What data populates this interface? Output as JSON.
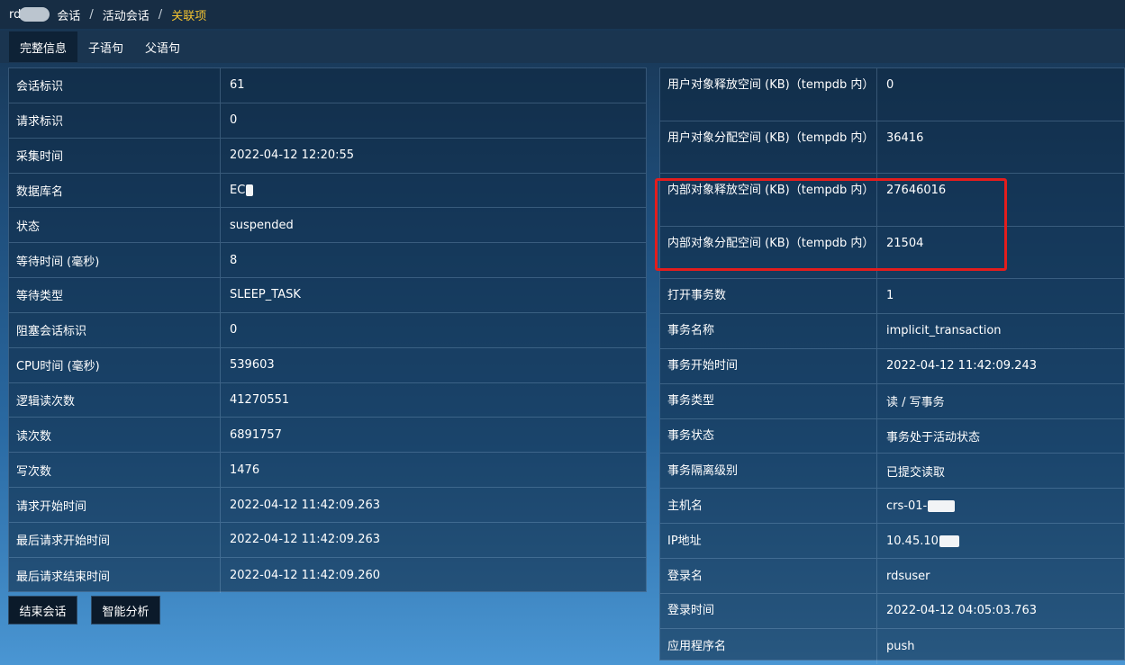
{
  "breadcrumb": {
    "root": "rd",
    "items": [
      "会话",
      "活动会话"
    ],
    "current": "关联项"
  },
  "tabs": [
    "完整信息",
    "子语句",
    "父语句"
  ],
  "left_rows": [
    {
      "key": "会话标识",
      "value": "61"
    },
    {
      "key": "请求标识",
      "value": "0"
    },
    {
      "key": "采集时间",
      "value": "2022-04-12 12:20:55"
    },
    {
      "key": "数据库名",
      "value": "EC"
    },
    {
      "key": "状态",
      "value": "suspended"
    },
    {
      "key": "等待时间 (毫秒)",
      "value": "8"
    },
    {
      "key": "等待类型",
      "value": "SLEEP_TASK"
    },
    {
      "key": "阻塞会话标识",
      "value": "0"
    },
    {
      "key": "CPU时间 (毫秒)",
      "value": "539603"
    },
    {
      "key": "逻辑读次数",
      "value": "41270551"
    },
    {
      "key": "读次数",
      "value": "6891757"
    },
    {
      "key": "写次数",
      "value": "1476"
    },
    {
      "key": "请求开始时间",
      "value": "2022-04-12 11:42:09.263"
    },
    {
      "key": "最后请求开始时间",
      "value": "2022-04-12 11:42:09.263"
    },
    {
      "key": "最后请求结束时间",
      "value": "2022-04-12 11:42:09.260"
    }
  ],
  "right_rows": [
    {
      "key": "用户对象释放空间 (KB)（tempdb 内）",
      "value": "0"
    },
    {
      "key": "用户对象分配空间 (KB)（tempdb 内）",
      "value": "36416"
    },
    {
      "key": "内部对象释放空间 (KB)（tempdb 内）",
      "value": "27646016"
    },
    {
      "key": "内部对象分配空间 (KB)（tempdb 内）",
      "value": "21504"
    },
    {
      "key": "打开事务数",
      "value": "1"
    },
    {
      "key": "事务名称",
      "value": "implicit_transaction"
    },
    {
      "key": "事务开始时间",
      "value": "2022-04-12 11:42:09.243"
    },
    {
      "key": "事务类型",
      "value": "读 / 写事务"
    },
    {
      "key": "事务状态",
      "value": "事务处于活动状态"
    },
    {
      "key": "事务隔离级别",
      "value": "已提交读取"
    },
    {
      "key": "主机名",
      "value": "crs-01-"
    },
    {
      "key": "IP地址",
      "value": "10.45.10"
    },
    {
      "key": "登录名",
      "value": "rdsuser"
    },
    {
      "key": "登录时间",
      "value": "2022-04-12 04:05:03.763"
    },
    {
      "key": "应用程序名",
      "value": "push"
    }
  ],
  "buttons": {
    "end_session": "结束会话",
    "smart_analysis": "智能分析"
  },
  "colors": {
    "breadcrumb_active": "#f2c230",
    "highlight_box": "#e31d1d"
  }
}
